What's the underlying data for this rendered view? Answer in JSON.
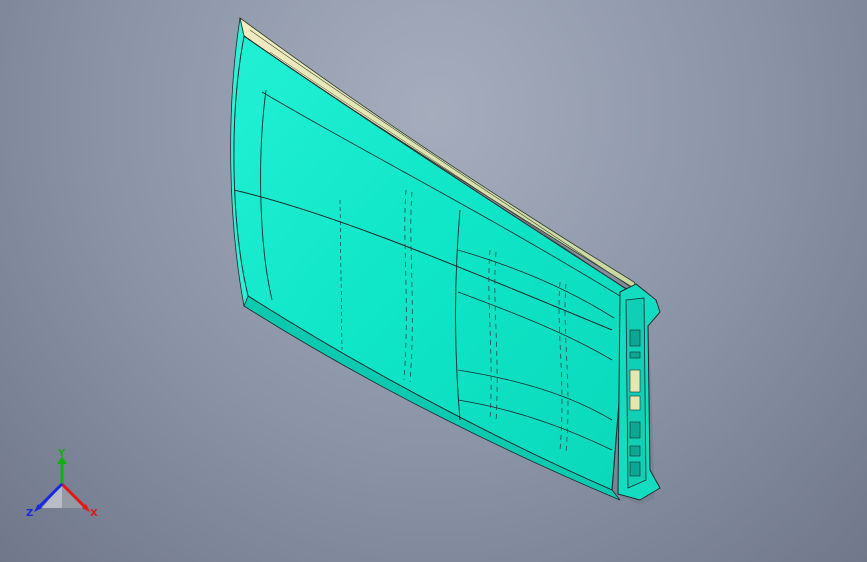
{
  "view": {
    "background_top": "#a5adbd",
    "background_bottom": "#6f7789",
    "part_color": "#10e6c8",
    "edge_color": "#1b2b2a"
  },
  "triad": {
    "x_label": "X",
    "y_label": "Y",
    "z_label": "Z",
    "x_color": "#e01818",
    "y_color": "#10b010",
    "z_color": "#1828e0"
  }
}
